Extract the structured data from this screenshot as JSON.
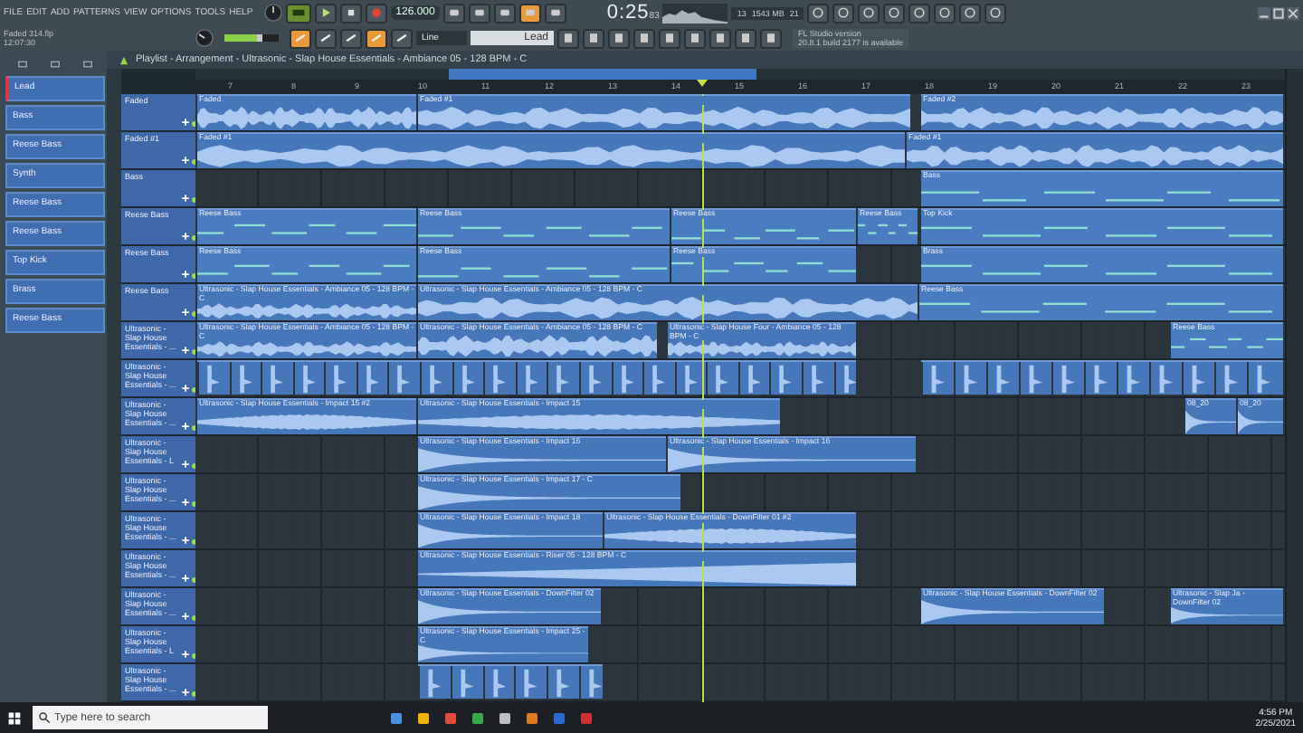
{
  "menu": [
    "FILE",
    "EDIT",
    "ADD",
    "PATTERNS",
    "VIEW",
    "OPTIONS",
    "TOOLS",
    "HELP"
  ],
  "project": {
    "file": "Faded 314.flp",
    "time": "12:07:30"
  },
  "transport": {
    "tempo": "126.000",
    "time": "0:25",
    "time_small": "83",
    "pattern_mode": "Line",
    "pattern": "Lead"
  },
  "master_volume": {
    "level": 0.7
  },
  "monitor": {
    "cpu": "13",
    "memory": "1543 MB",
    "polyphony": "21"
  },
  "hint": {
    "title": "FL Studio version",
    "text": "20.8.1 build 2177 is available"
  },
  "playlist": {
    "title": "Playlist - Arrangement - Ultrasonic - Slap House Essentials - Ambiance 05 - 128 BPM - C",
    "ruler": [
      "7",
      "8",
      "9",
      "10",
      "11",
      "12",
      "13",
      "14",
      "15",
      "16",
      "17",
      "18",
      "19",
      "20",
      "21",
      "22",
      "23"
    ]
  },
  "channels": [
    {
      "name": "Lead",
      "selected": true
    },
    {
      "name": "Bass",
      "selected": false
    },
    {
      "name": "Reese Bass",
      "selected": false
    },
    {
      "name": "Synth",
      "selected": false
    },
    {
      "name": "Reese Bass",
      "selected": false
    },
    {
      "name": "Reese Bass",
      "selected": false
    },
    {
      "name": "Top Kick",
      "selected": false
    },
    {
      "name": "Brass",
      "selected": false
    },
    {
      "name": "Reese Bass",
      "selected": false
    }
  ],
  "tracks": [
    {
      "name": "Faded",
      "clips": [
        {
          "kind": "audio",
          "label": "Faded"
        },
        {
          "kind": "audio",
          "label": "Faded #1"
        },
        {
          "kind": "audio",
          "label": "Faded #2"
        }
      ]
    },
    {
      "name": "Faded #1",
      "clips": [
        {
          "kind": "audio",
          "label": "Faded #1"
        },
        {
          "kind": "audio",
          "label": "Faded #1"
        }
      ]
    },
    {
      "name": "Bass",
      "clips": [
        {
          "kind": "pattern",
          "label": "Bass"
        }
      ]
    },
    {
      "name": "Reese Bass",
      "clips": [
        {
          "kind": "pattern",
          "label": "Reese Bass"
        },
        {
          "kind": "pattern",
          "label": "Reese Bass"
        },
        {
          "kind": "pattern",
          "label": "Reese Bass"
        },
        {
          "kind": "pattern",
          "label": "Reese Bass"
        },
        {
          "kind": "pattern",
          "label": "Top Kick"
        }
      ]
    },
    {
      "name": "Reese Bass",
      "clips": [
        {
          "kind": "pattern",
          "label": "Reese Bass"
        },
        {
          "kind": "pattern",
          "label": "Reese Bass"
        },
        {
          "kind": "pattern",
          "label": "Reese Bass"
        },
        {
          "kind": "pattern",
          "label": "Brass"
        }
      ]
    },
    {
      "name": "Reese Bass",
      "clips": [
        {
          "kind": "audio",
          "label": "Ultrasonic - Slap House Essentials - Ambiance 05 - 128 BPM - C"
        },
        {
          "kind": "audio",
          "label": "Ultrasonic - Slap House Essentials - Ambiance 05 - 128 BPM - C"
        },
        {
          "kind": "pattern",
          "label": "Reese Bass"
        }
      ]
    },
    {
      "name": "Ultrasonic - Slap House Essentials - ...",
      "clips": [
        {
          "kind": "audio",
          "label": "Ultrasonic - Slap House Essentials - Ambiance 05 - 128 BPM - C"
        },
        {
          "kind": "audio",
          "label": "Ultrasonic - Slap House Essentials - Ambiance 05 - 128 BPM - C"
        },
        {
          "kind": "audio",
          "label": "Ultrasonic - Slap House Four - Ambiance 05 - 128 BPM - C"
        },
        {
          "kind": "pattern",
          "label": "Reese Bass"
        }
      ]
    },
    {
      "name": "Ultrasonic - Slap House Essentials - ...",
      "clips": [
        {
          "kind": "slices"
        },
        {
          "kind": "slices"
        }
      ]
    },
    {
      "name": "Ultrasonic - Slap House Essentials - ...",
      "clips": [
        {
          "kind": "swell",
          "label": "Ultrasonic - Slap House Essentials - Impact 15 #2"
        },
        {
          "kind": "swell",
          "label": "Ultrasonic - Slap House Essentials - Impact 15"
        },
        {
          "kind": "impact",
          "label": "08_20"
        },
        {
          "kind": "impact",
          "label": "08_20"
        }
      ]
    },
    {
      "name": "Ultrasonic - Slap House Essentials - L",
      "clips": [
        {
          "kind": "impact",
          "label": "Ultrasonic - Slap House Essentials - Impact 16"
        },
        {
          "kind": "impact",
          "label": "Ultrasonic - Slap House Essentials - Impact 16"
        }
      ]
    },
    {
      "name": "Ultrasonic - Slap House Essentials - ...",
      "clips": [
        {
          "kind": "impact",
          "label": "Ultrasonic - Slap House Essentials - Impact 17 - C"
        }
      ]
    },
    {
      "name": "Ultrasonic - Slap House Essentials - ...",
      "clips": [
        {
          "kind": "impact",
          "label": "Ultrasonic - Slap House Essentials - Impact 18"
        },
        {
          "kind": "swell",
          "label": "Ultrasonic - Slap House Essentials - DownFilter 01 #2"
        }
      ]
    },
    {
      "name": "Ultrasonic - Slap House Essentials - ...",
      "clips": [
        {
          "kind": "riser",
          "label": "Ultrasonic - Slap House Essentials - Riser 05 - 128 BPM - C"
        }
      ]
    },
    {
      "name": "Ultrasonic - Slap House Essentials - ...",
      "clips": [
        {
          "kind": "impact",
          "label": "Ultrasonic - Slap House Essentials - DownFilter 02"
        },
        {
          "kind": "impact",
          "label": "Ultrasonic - Slap House Essentials - DownFilter 02"
        },
        {
          "kind": "impact",
          "label": "Ultrasonic - Slap Ja - DownFilter 02"
        }
      ]
    },
    {
      "name": "Ultrasonic - Slap House Essentials - L",
      "clips": [
        {
          "kind": "impact",
          "label": "Ultrasonic - Slap House Essentials - Impact 25 - C"
        }
      ]
    },
    {
      "name": "Ultrasonic - Slap House Essentials - ...",
      "clips": [
        {
          "kind": "slices"
        }
      ]
    }
  ],
  "taskbar": {
    "search_placeholder": "Type here to search",
    "time": "4:56 PM",
    "date": "2/25/2021"
  }
}
